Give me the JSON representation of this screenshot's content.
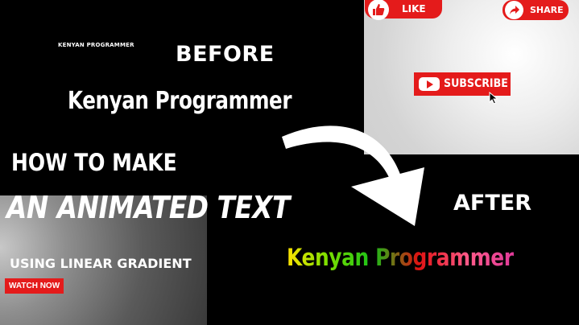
{
  "brand_small": "KENYAN PROGRAMMER",
  "before_label": "BEFORE",
  "kp_before": "Kenyan Programmer",
  "headline_line1": "HOW TO MAKE",
  "headline_line2": "AN ANIMATED TEXT",
  "subtitle": "USING LINEAR GRADIENT",
  "watch_button": "WATCH NOW",
  "after_label": "AFTER",
  "kp_after": "Kenyan Programmer",
  "like_button": "LIKE",
  "share_button": "SHARE",
  "subscribe_button": "SUBSCRIBE",
  "icons": {
    "like": "thumbs-up-icon",
    "share": "share-arrow-icon",
    "subscribe": "youtube-play-icon",
    "cursor": "mouse-pointer-icon",
    "arrow": "curved-arrow-icon"
  },
  "colors": {
    "accent_red": "#e41b1b",
    "background": "#000000",
    "text": "#ffffff"
  }
}
